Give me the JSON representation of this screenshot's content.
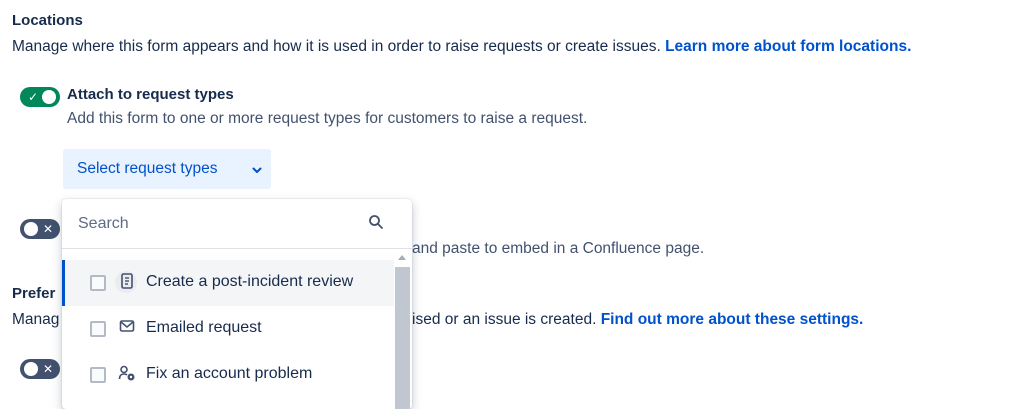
{
  "locations": {
    "title": "Locations",
    "description": "Manage where this form appears and how it is used in order to raise requests or create issues.",
    "link": "Learn more about form locations."
  },
  "attach": {
    "toggle_on": true,
    "title": "Attach to request types",
    "description": "Add this form to one or more request types for customers to raise a request.",
    "select_label": "Select request types"
  },
  "embed": {
    "toggle_on": false,
    "description_partial": "and paste to embed in a Confluence page."
  },
  "preferences": {
    "title_partial": "Prefer",
    "description_start": "Manag",
    "description_end": "ised or an issue is created.",
    "link": "Find out more about these settings."
  },
  "third_toggle": {
    "toggle_on": false
  },
  "dropdown": {
    "search_placeholder": "Search",
    "items": [
      {
        "label": "Create a post-incident review",
        "icon": "document-icon",
        "checked": false,
        "active": true
      },
      {
        "label": "Emailed request",
        "icon": "envelope-icon",
        "checked": false,
        "active": false
      },
      {
        "label": "Fix an account problem",
        "icon": "user-settings-icon",
        "checked": false,
        "active": false
      }
    ]
  },
  "colors": {
    "toggle_on": "#00875a",
    "toggle_off": "#42526e",
    "link": "#0052cc",
    "button_bg": "#e9f2ff"
  }
}
